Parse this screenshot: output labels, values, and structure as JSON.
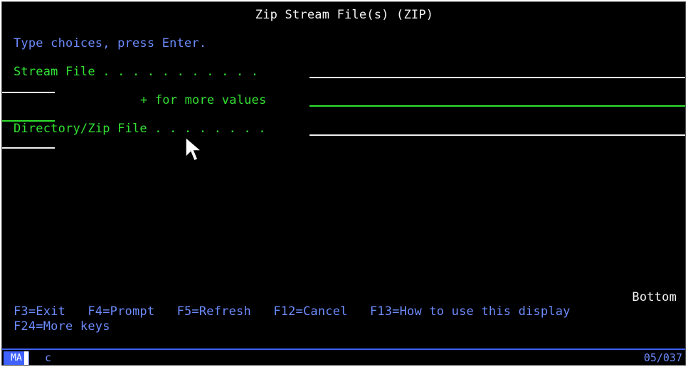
{
  "screen": {
    "title": "Zip Stream File(s) (ZIP)",
    "instructions": "Type choices, press Enter.",
    "fields": {
      "stream_file_label": "Stream File . . . . . . . . . . .",
      "more_values_label": "+ for more values",
      "directory_zip_label": "Directory/Zip File . . . . . . . .",
      "stream_file_value": "",
      "more_values_value": "",
      "directory_zip_value": ""
    },
    "position_indicator": "Bottom",
    "function_keys_row1": "F3=Exit   F4=Prompt   F5=Refresh   F12=Cancel   F13=How to use this display",
    "function_keys_row2": "F24=More keys"
  },
  "status_bar": {
    "session_indicator": "MA",
    "input_mode": "c",
    "cursor_position": "05/037"
  },
  "colors": {
    "background": "#000000",
    "title_text": "#f2f2f2",
    "instruction_text": "#6d8cff",
    "prompt_text": "#33e033",
    "status_accent": "#3f62ff"
  }
}
